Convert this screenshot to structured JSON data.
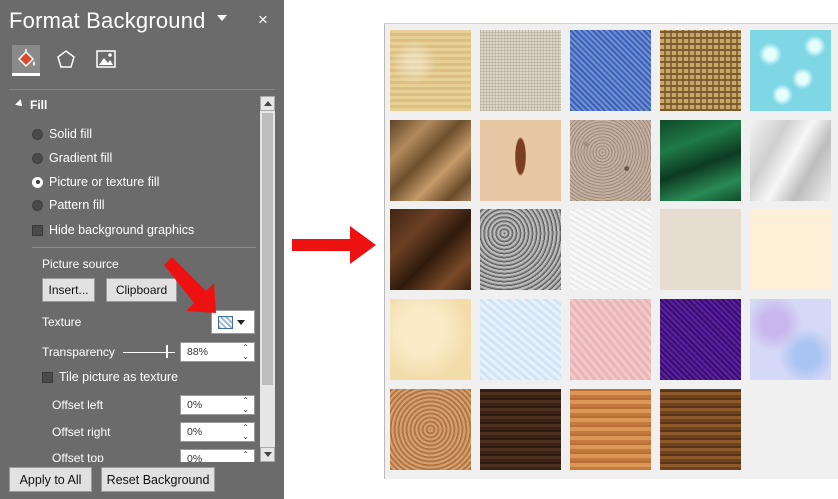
{
  "pane": {
    "title": "Format Background",
    "close_glyph": "×",
    "tabs": [
      {
        "name": "fill-effects-tab",
        "icon": "paint-bucket-icon"
      },
      {
        "name": "effects-tab",
        "icon": "pentagon-icon"
      },
      {
        "name": "picture-tab",
        "icon": "picture-icon"
      }
    ],
    "section": "Fill",
    "fill_options": {
      "solid": "Solid fill",
      "gradient": "Gradient fill",
      "picture_texture": "Picture or texture fill",
      "pattern": "Pattern fill",
      "selected": "picture_texture"
    },
    "hide_graphics": "Hide background graphics",
    "picture_source_label": "Picture source",
    "insert_button": "Insert...",
    "clipboard_button": "Clipboard",
    "texture_label": "Texture",
    "transparency_label": "Transparency",
    "transparency_value": "88%",
    "tile_label": "Tile picture as texture",
    "offset_left_label": "Offset left",
    "offset_left_value": "0%",
    "offset_right_label": "Offset right",
    "offset_right_value": "0%",
    "offset_top_label": "Offset top",
    "offset_top_value": "0%",
    "apply_all_button": "Apply to All",
    "reset_button": "Reset Background"
  },
  "colors": {
    "pane_bg": "#6b6b6b",
    "arrow_red": "#ee1111"
  },
  "gallery": {
    "textures": [
      "papyrus",
      "canvas",
      "denim",
      "woven-mat",
      "water-droplets",
      "paper-bag",
      "fish-fossil",
      "sand",
      "green-marble",
      "white-marble",
      "brown-marble",
      "granite",
      "newsprint",
      "recycled-paper",
      "parchment",
      "stationery",
      "blue-tissue-paper",
      "pink-tissue-paper",
      "purple-mesh",
      "bouquet",
      "cork",
      "walnut",
      "oak",
      "medium-wood"
    ]
  }
}
